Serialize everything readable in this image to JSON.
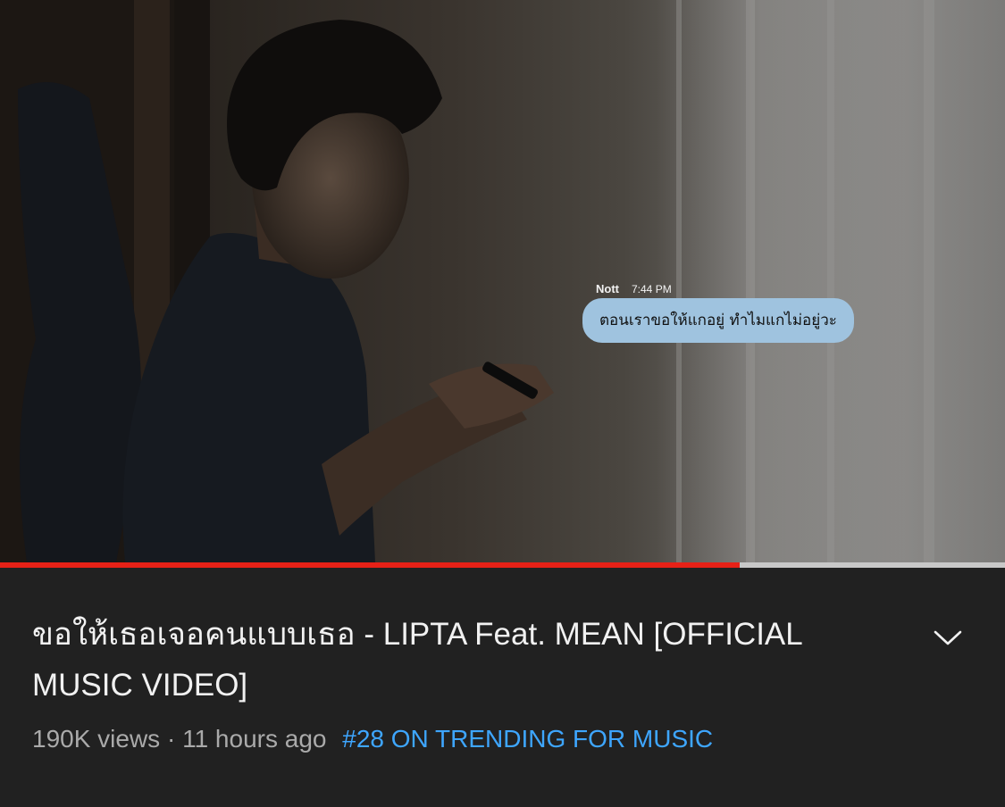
{
  "player": {
    "chat_overlay": {
      "sender": "Nott",
      "time": "7:44 PM",
      "message": "ตอนเราขอให้แกอยู่ ทำไมแกไม่อยู่วะ"
    },
    "progress": 0.736
  },
  "video": {
    "title": "ขอให้เธอเจอคนแบบเธอ - LIPTA Feat. MEAN [OFFICIAL MUSIC VIDEO]",
    "views": "190K views",
    "separator": "·",
    "age": "11 hours ago",
    "trending": "#28 ON TRENDING FOR MUSIC"
  },
  "icons": {
    "expand": "chevron-down-icon"
  },
  "colors": {
    "background": "#212121",
    "progress_played": "#e62117",
    "progress_buffer": "#c8c8c8",
    "trending_link": "#3ea6ff",
    "chat_bubble": "#9fc3df"
  }
}
